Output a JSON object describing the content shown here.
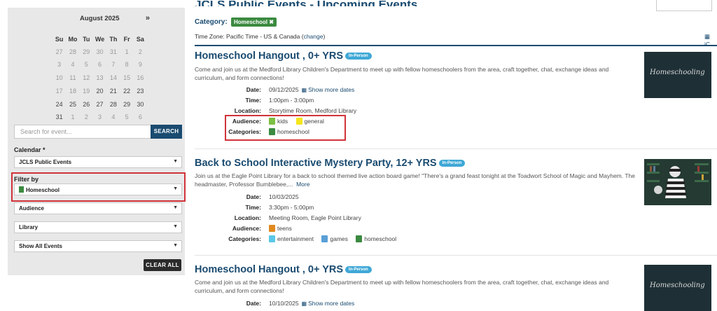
{
  "calendar": {
    "month": "August 2025",
    "next": "»",
    "dow": [
      "Su",
      "Mo",
      "Tu",
      "We",
      "Th",
      "Fr",
      "Sa"
    ],
    "weeks": [
      [
        {
          "d": "27",
          "dim": true
        },
        {
          "d": "28",
          "dim": true
        },
        {
          "d": "29",
          "dim": true
        },
        {
          "d": "30",
          "dim": true
        },
        {
          "d": "31",
          "dim": true
        },
        {
          "d": "1",
          "dim": true
        },
        {
          "d": "2",
          "dim": true
        }
      ],
      [
        {
          "d": "3",
          "dim": true
        },
        {
          "d": "4",
          "dim": true
        },
        {
          "d": "5",
          "dim": true
        },
        {
          "d": "6",
          "dim": true
        },
        {
          "d": "7",
          "dim": true
        },
        {
          "d": "8",
          "dim": true
        },
        {
          "d": "9",
          "dim": true
        }
      ],
      [
        {
          "d": "10",
          "dim": true
        },
        {
          "d": "11",
          "dim": true
        },
        {
          "d": "12",
          "dim": true
        },
        {
          "d": "13",
          "dim": true
        },
        {
          "d": "14",
          "dim": true
        },
        {
          "d": "15",
          "dim": true
        },
        {
          "d": "16",
          "dim": true
        }
      ],
      [
        {
          "d": "17",
          "dim": true
        },
        {
          "d": "18",
          "dim": true
        },
        {
          "d": "19",
          "dim": true
        },
        {
          "d": "20",
          "dim": false
        },
        {
          "d": "21",
          "dim": false
        },
        {
          "d": "22",
          "dim": false
        },
        {
          "d": "23",
          "dim": false
        }
      ],
      [
        {
          "d": "24",
          "dim": false
        },
        {
          "d": "25",
          "dim": false
        },
        {
          "d": "26",
          "dim": false
        },
        {
          "d": "27",
          "dim": false
        },
        {
          "d": "28",
          "dim": false
        },
        {
          "d": "29",
          "dim": false
        },
        {
          "d": "30",
          "dim": false
        }
      ],
      [
        {
          "d": "31",
          "dim": false
        },
        {
          "d": "1",
          "dim": true
        },
        {
          "d": "2",
          "dim": true
        },
        {
          "d": "3",
          "dim": true
        },
        {
          "d": "4",
          "dim": true
        },
        {
          "d": "5",
          "dim": true
        },
        {
          "d": "6",
          "dim": true
        }
      ]
    ]
  },
  "sidebar": {
    "search_placeholder": "Search for event...",
    "search_button": "SEARCH",
    "calendar_label": "Calendar *",
    "calendar_value": "JCLS Public Events",
    "filter_label": "Filter by",
    "filter_value": "Homeschool",
    "filter_color": "#3b8a40",
    "audience_value": "Audience",
    "library_value": "Library",
    "show_value": "Show All Events",
    "clear_button": "CLEAR ALL"
  },
  "main": {
    "page_title": "JCLS Public Events - Upcoming Events",
    "category_label": "Category:",
    "category_badge": "Homeschool",
    "badge_close": "✖",
    "tz_text": "Time Zone: Pacific Time - US & Canada (",
    "tz_link": "change",
    "tz_end": ")",
    "ical_label": "iC"
  },
  "labels": {
    "date": "Date:",
    "time": "Time:",
    "location": "Location:",
    "audience": "Audience:",
    "categories": "Categories:",
    "show_more": "Show more dates",
    "more": "More"
  },
  "events": [
    {
      "title": "Homeschool Hangout , 0+ YRS",
      "pill": "In-Person",
      "desc": "Come and join us at the Medford Library Children's Department to meet up with fellow homeschoolers from the area, craft together, chat, exchange ideas and curriculum, and form connections!",
      "date": "09/12/2025",
      "time": "1:00pm - 3:00pm",
      "location": "Storytime Room, Medford Library",
      "audience": [
        {
          "name": "kids",
          "color": "#7cc043"
        },
        {
          "name": "general",
          "color": "#f5e61c"
        }
      ],
      "categories": [
        {
          "name": "homeschool",
          "color": "#3b8a40"
        }
      ],
      "thumb_text": "Homeschooling"
    },
    {
      "title": "Back to School Interactive Mystery Party, 12+ YRS",
      "pill": "In-Person",
      "desc": "Join us at the Eagle Point Library for a back to school themed live action board game! \"There's a grand feast tonight at the Toadwort School of Magic and Mayhem. The headmaster, Professor Bumblebee,...",
      "date": "10/03/2025",
      "time": "3:30pm - 5:00pm",
      "location": "Meeting Room, Eagle Point Library",
      "audience": [
        {
          "name": "teens",
          "color": "#e08a1e"
        }
      ],
      "categories": [
        {
          "name": "entertainment",
          "color": "#5bc8e8"
        },
        {
          "name": "games",
          "color": "#5a9fd6"
        },
        {
          "name": "homeschool",
          "color": "#3b8a40"
        }
      ]
    },
    {
      "title": "Homeschool Hangout , 0+ YRS",
      "pill": "In-Person",
      "desc": "Come and join us at the Medford Library Children's Department to meet up with fellow homeschoolers from the area, craft together, chat, exchange ideas and curriculum, and form connections!",
      "date": "10/10/2025",
      "thumb_text": "Homeschooling"
    }
  ]
}
